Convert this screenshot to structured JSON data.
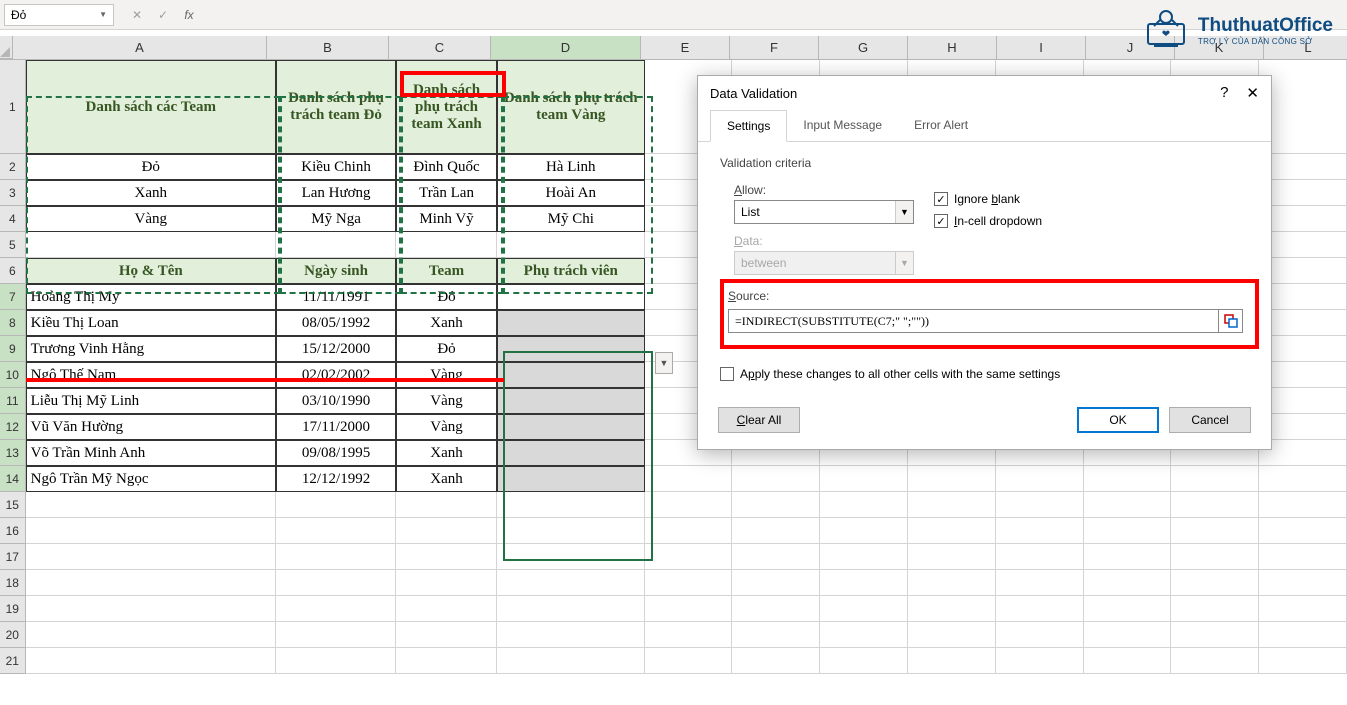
{
  "namebox": "Đỏ",
  "columns": [
    "A",
    "B",
    "C",
    "D",
    "E",
    "F",
    "G",
    "H",
    "I",
    "J",
    "K",
    "L"
  ],
  "colWidths": {
    "A": 254,
    "B": 122,
    "C": 102,
    "D": 150,
    "E": 89,
    "F": 89,
    "G": 89,
    "H": 89,
    "I": 89,
    "J": 89,
    "K": 89,
    "L": 89
  },
  "header1": {
    "A": "Danh sách các Team",
    "B": "Danh sách phụ trách team Đỏ",
    "C": "Danh sách phụ trách team Xanh",
    "D": "Danh sách phụ trách team Vàng"
  },
  "teams": [
    {
      "A": "Đỏ",
      "B": "Kiều Chinh",
      "C": "Đình Quốc",
      "D": "Hà Linh"
    },
    {
      "A": "Xanh",
      "B": "Lan Hương",
      "C": "Trần Lan",
      "D": "Hoài An"
    },
    {
      "A": "Vàng",
      "B": "Mỹ Nga",
      "C": "Minh Vỹ",
      "D": "Mỹ Chi"
    }
  ],
  "header2": {
    "A": "Họ & Tên",
    "B": "Ngày sinh",
    "C": "Team",
    "D": "Phụ trách viên"
  },
  "people": [
    {
      "name": "Hoàng Thị My",
      "dob": "11/11/1991",
      "team": "Đỏ",
      "pv": ""
    },
    {
      "name": "Kiều Thị Loan",
      "dob": "08/05/1992",
      "team": "Xanh",
      "pv": ""
    },
    {
      "name": "Trương Vinh Hằng",
      "dob": "15/12/2000",
      "team": "Đỏ",
      "pv": ""
    },
    {
      "name": "Ngô Thế Nam",
      "dob": "02/02/2002",
      "team": "Vàng",
      "pv": ""
    },
    {
      "name": "Liễu Thị Mỹ Linh",
      "dob": "03/10/1990",
      "team": "Vàng",
      "pv": ""
    },
    {
      "name": "Vũ Văn Hường",
      "dob": "17/11/2000",
      "team": "Vàng",
      "pv": ""
    },
    {
      "name": "Võ Trần Minh Anh",
      "dob": "09/08/1995",
      "team": "Xanh",
      "pv": ""
    },
    {
      "name": "Ngô Trần Mỹ Ngọc",
      "dob": "12/12/1992",
      "team": "Xanh",
      "pv": ""
    }
  ],
  "rowNumbers": [
    1,
    2,
    3,
    4,
    5,
    6,
    7,
    8,
    9,
    10,
    11,
    12,
    13,
    14,
    15,
    16,
    17,
    18,
    19,
    20,
    21
  ],
  "dialog": {
    "title": "Data Validation",
    "tabs": {
      "settings": "Settings",
      "input": "Input Message",
      "error": "Error Alert"
    },
    "criteria_label": "Validation criteria",
    "allow_label": "Allow:",
    "allow_value": "List",
    "data_label": "Data:",
    "data_value": "between",
    "ignore_blank": "Ignore blank",
    "incell": "In-cell dropdown",
    "source_label": "Source:",
    "source_value": "=INDIRECT(SUBSTITUTE(C7;\" \";\"\"))",
    "apply_all": "Apply these changes to all other cells with the same settings",
    "clear": "Clear All",
    "ok": "OK",
    "cancel": "Cancel"
  },
  "watermark": {
    "title": "ThuthuatOffice",
    "sub": "TRỢ LÝ CỦA DÂN CÔNG SỞ"
  }
}
